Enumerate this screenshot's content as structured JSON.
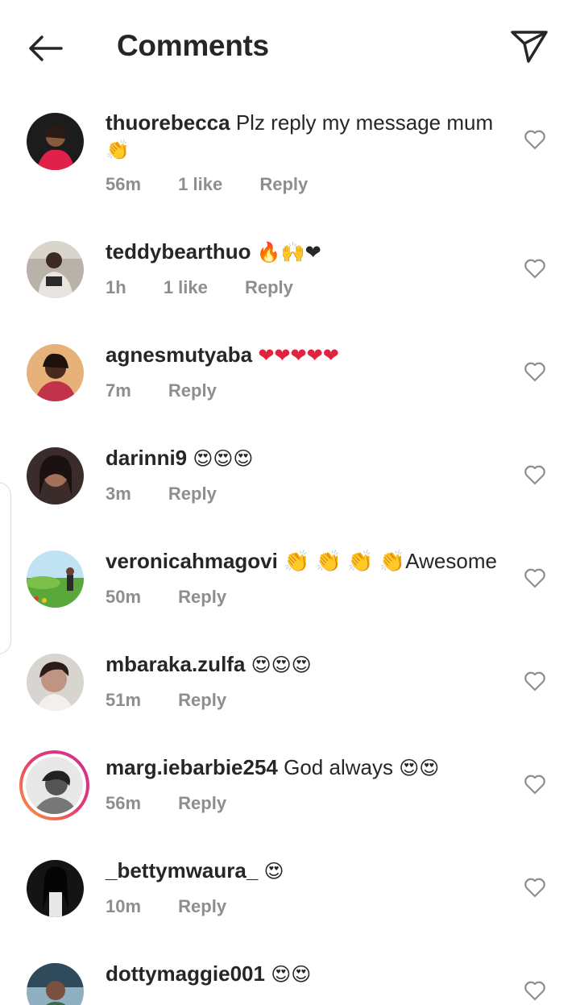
{
  "header": {
    "title": "Comments"
  },
  "comments": [
    {
      "username": "thuorebecca",
      "text": "Plz reply my message mum",
      "emoji": "👏",
      "time": "56m",
      "likes": "1 like",
      "reply": "Reply"
    },
    {
      "username": "teddybearthuo",
      "text": "",
      "emoji": "🔥🙌❤",
      "time": "1h",
      "likes": "1 like",
      "reply": "Reply"
    },
    {
      "username": "agnesmutyaba",
      "text": "",
      "emoji": "❤❤❤❤❤",
      "time": "7m",
      "likes": "",
      "reply": "Reply"
    },
    {
      "username": "darinni9",
      "text": "",
      "emoji": "😍😍😍",
      "time": "3m",
      "likes": "",
      "reply": "Reply"
    },
    {
      "username": "veronicahmagovi",
      "text": "👏 👏 👏 👏Awesome",
      "emoji": "",
      "time": "50m",
      "likes": "",
      "reply": "Reply"
    },
    {
      "username": "mbaraka.zulfa",
      "text": "",
      "emoji": "😍😍😍",
      "time": "51m",
      "likes": "",
      "reply": "Reply"
    },
    {
      "username": "marg.iebarbie254",
      "text": "God always",
      "emoji": "😍😍",
      "time": "56m",
      "likes": "",
      "reply": "Reply"
    },
    {
      "username": "_bettymwaura_",
      "text": "",
      "emoji": "😍",
      "time": "10m",
      "likes": "",
      "reply": "Reply"
    },
    {
      "username": "dottymaggie001",
      "text": "",
      "emoji": "😍😍",
      "time": "",
      "likes": "",
      "reply": ""
    }
  ],
  "icons": {
    "back": "arrow-left-icon",
    "send": "paper-plane-icon",
    "like": "heart-outline-icon"
  },
  "colors": {
    "text": "#262626",
    "muted": "#8e8e8e",
    "ring": "#e83b6b"
  }
}
